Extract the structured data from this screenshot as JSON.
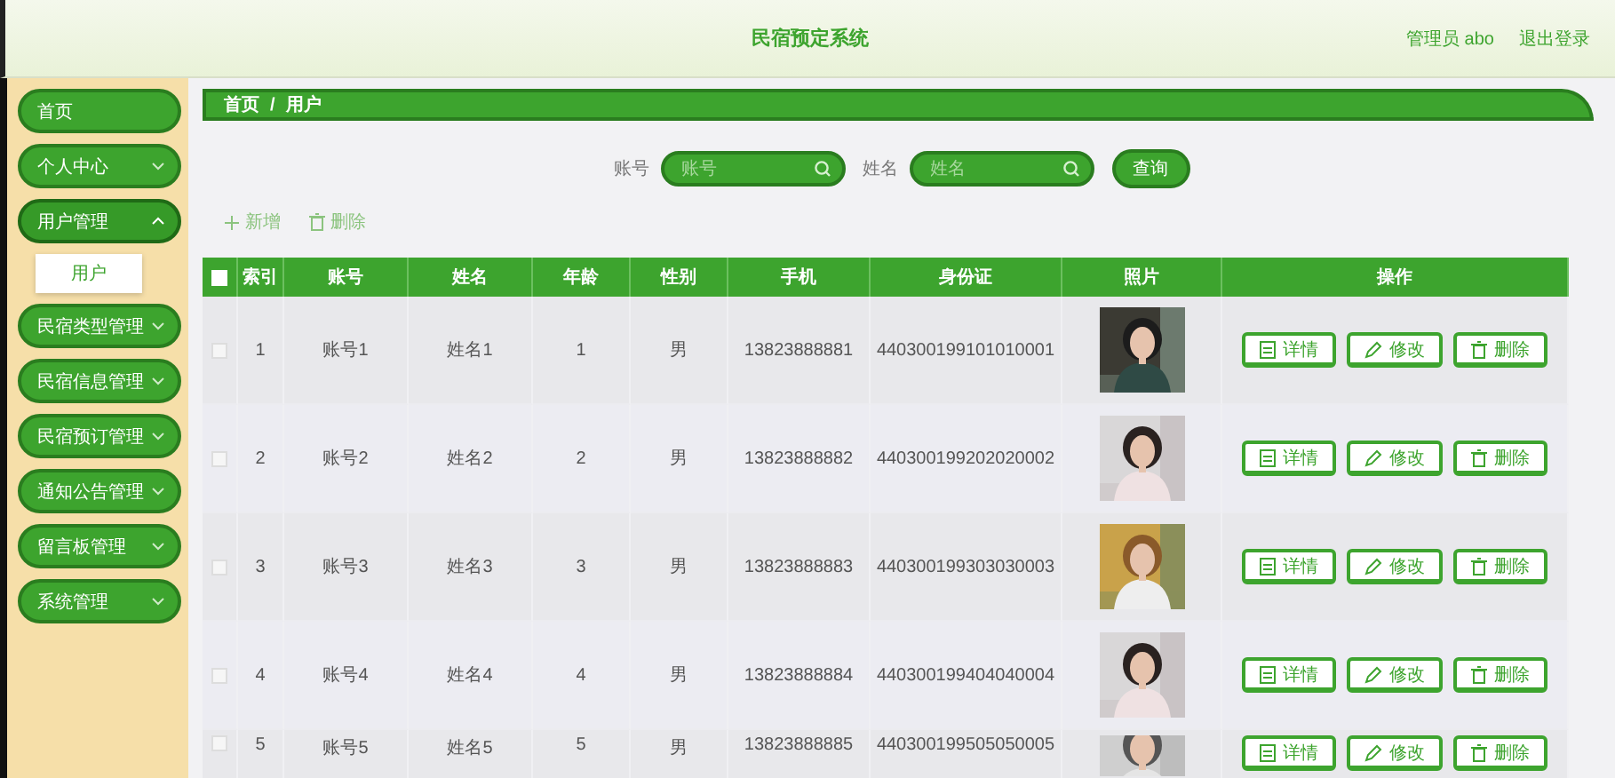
{
  "header": {
    "title": "民宿预定系统",
    "user_label": "管理员 abo",
    "logout": "退出登录"
  },
  "sidebar": {
    "items": [
      {
        "label": "首页",
        "kind": "link"
      },
      {
        "label": "个人中心",
        "kind": "menu",
        "expanded": false
      },
      {
        "label": "用户管理",
        "kind": "menu",
        "expanded": true,
        "children": [
          {
            "label": "用户",
            "selected": true
          }
        ]
      },
      {
        "label": "民宿类型管理",
        "kind": "menu",
        "expanded": false
      },
      {
        "label": "民宿信息管理",
        "kind": "menu",
        "expanded": false
      },
      {
        "label": "民宿预订管理",
        "kind": "menu",
        "expanded": false
      },
      {
        "label": "通知公告管理",
        "kind": "menu",
        "expanded": false
      },
      {
        "label": "留言板管理",
        "kind": "menu",
        "expanded": false
      },
      {
        "label": "系统管理",
        "kind": "menu",
        "expanded": false
      }
    ]
  },
  "breadcrumb": {
    "items": [
      "首页",
      "用户"
    ],
    "separator": "/"
  },
  "search": {
    "fields": [
      {
        "label": "账号",
        "placeholder": "账号"
      },
      {
        "label": "姓名",
        "placeholder": "姓名"
      }
    ],
    "button": "查询"
  },
  "actions": [
    {
      "kind": "add",
      "label": "新增"
    },
    {
      "kind": "delete",
      "label": "删除"
    }
  ],
  "table": {
    "select_all": false,
    "columns": [
      "索引",
      "账号",
      "姓名",
      "年龄",
      "性别",
      "手机",
      "身份证",
      "照片",
      "操作"
    ],
    "rows": [
      {
        "checked": false,
        "cells": [
          "1",
          "账号1",
          "姓名1",
          "1",
          "男",
          "13823888881",
          "440300199101010001"
        ],
        "buttons": [
          {
            "kind": "detail",
            "label": "详情"
          },
          {
            "kind": "edit",
            "label": "修改"
          },
          {
            "kind": "delete",
            "label": "删除"
          }
        ]
      },
      {
        "checked": false,
        "cells": [
          "2",
          "账号2",
          "姓名2",
          "2",
          "男",
          "13823888882",
          "440300199202020002"
        ],
        "buttons": [
          {
            "kind": "detail",
            "label": "详情"
          },
          {
            "kind": "edit",
            "label": "修改"
          },
          {
            "kind": "delete",
            "label": "删除"
          }
        ]
      },
      {
        "checked": false,
        "cells": [
          "3",
          "账号3",
          "姓名3",
          "3",
          "男",
          "13823888883",
          "440300199303030003"
        ],
        "buttons": [
          {
            "kind": "detail",
            "label": "详情"
          },
          {
            "kind": "edit",
            "label": "修改"
          },
          {
            "kind": "delete",
            "label": "删除"
          }
        ]
      },
      {
        "checked": false,
        "cells": [
          "4",
          "账号4",
          "姓名4",
          "4",
          "男",
          "13823888884",
          "440300199404040004"
        ],
        "buttons": [
          {
            "kind": "detail",
            "label": "详情"
          },
          {
            "kind": "edit",
            "label": "修改"
          },
          {
            "kind": "delete",
            "label": "删除"
          }
        ]
      },
      {
        "checked": false,
        "cells": [
          "5",
          "账号5",
          "姓名5",
          "5",
          "男",
          "13823888885",
          "440300199505050005"
        ],
        "buttons": [
          {
            "kind": "detail",
            "label": "详情"
          },
          {
            "kind": "edit",
            "label": "修改"
          },
          {
            "kind": "delete",
            "label": "删除"
          }
        ]
      }
    ]
  }
}
